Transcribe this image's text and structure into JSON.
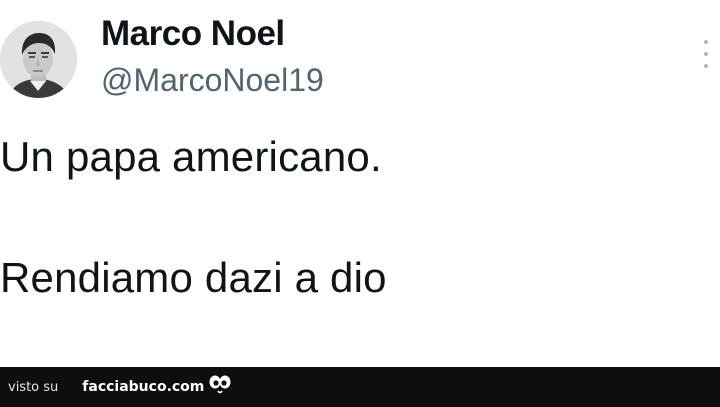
{
  "author": {
    "display_name": "Marco Noel",
    "handle": "@MarcoNoel19"
  },
  "tweet": {
    "lines": [
      "Un papa americano.",
      "Rendiamo dazi a dio"
    ]
  },
  "icons": {
    "more": "more-vertical-icon",
    "logo": "eyes-icon"
  },
  "footer": {
    "prefix": "visto su",
    "brand": "facciabuco.com"
  },
  "colors": {
    "name": "#0f1419",
    "handle": "#536471",
    "footer_bg": "#0e0e0e"
  }
}
